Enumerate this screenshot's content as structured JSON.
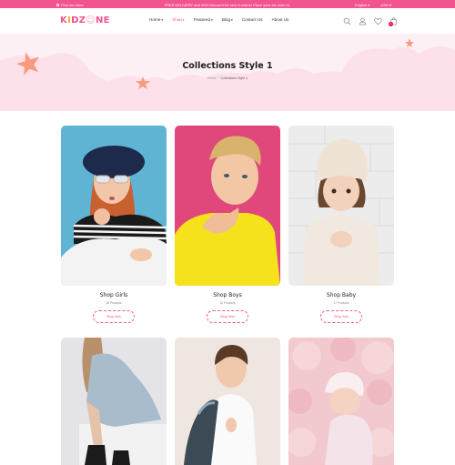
{
  "topbar": {
    "store_link": "Find our store",
    "promo": "FREE DELIVERY and 40% Discount for next 3 orders! Place your 1st order in.",
    "language": "English",
    "currency": "USD"
  },
  "header": {
    "logo": [
      "K",
      "I",
      "D",
      "Z",
      "☺",
      "N",
      "E"
    ],
    "logo_colors": [
      "#f2548f",
      "#f5a623",
      "#e84a8a",
      "#f2548f",
      "#f8a9c4",
      "#f2548f",
      "#f2548f"
    ],
    "nav": [
      {
        "label": "Home",
        "has_dropdown": true,
        "active": false
      },
      {
        "label": "Shop",
        "has_dropdown": true,
        "active": true
      },
      {
        "label": "Featured",
        "has_dropdown": true,
        "active": false
      },
      {
        "label": "Blog",
        "has_dropdown": true,
        "active": false
      },
      {
        "label": "Contact Us",
        "has_dropdown": false,
        "active": false
      },
      {
        "label": "About Us",
        "has_dropdown": false,
        "active": false
      }
    ],
    "icons": [
      "search-icon",
      "account-icon",
      "wishlist-icon",
      "cart-icon"
    ],
    "cart_count": "1",
    "accent": "#f2548f"
  },
  "hero": {
    "title": "Collections Style 1",
    "breadcrumb": {
      "home": "Home",
      "separator": "/",
      "current": "Collections Style 1"
    }
  },
  "collections": [
    {
      "name": "Shop Girls",
      "count": "16 Products",
      "button": "Shop Now"
    },
    {
      "name": "Shop Boys",
      "count": "15 Products",
      "button": "Shop Now"
    },
    {
      "name": "Shop Baby",
      "count": "17 Products",
      "button": "Shop Now"
    },
    {
      "name": "",
      "count": "",
      "button": ""
    },
    {
      "name": "",
      "count": "",
      "button": ""
    },
    {
      "name": "",
      "count": "",
      "button": ""
    }
  ]
}
